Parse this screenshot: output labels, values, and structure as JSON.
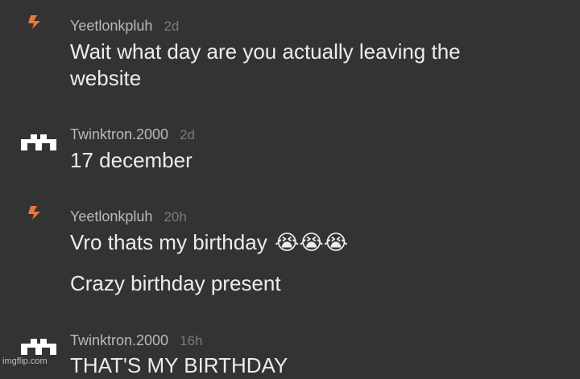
{
  "comments": [
    {
      "username": "Yeetlonkpluh",
      "time": "2d",
      "avatar_icon": "lightning-bolt-icon",
      "lines": [
        "Wait what day are you actually leaving the website"
      ]
    },
    {
      "username": "Twinktron.2000",
      "time": "2d",
      "avatar_icon": "pixel-invader-icon",
      "lines": [
        "17 december"
      ]
    },
    {
      "username": "Yeetlonkpluh",
      "time": "20h",
      "avatar_icon": "lightning-bolt-icon",
      "lines": [
        "Vro thats my birthday",
        "Crazy birthday present"
      ],
      "emojis": "😭😭😭"
    },
    {
      "username": "Twinktron.2000",
      "time": "16h",
      "avatar_icon": "pixel-invader-icon",
      "lines": [
        "THAT'S MY BIRTHDAY"
      ]
    }
  ],
  "watermark": "imgflip.com",
  "colors": {
    "background": "#333333",
    "username": "#b9b9b9",
    "timestamp": "#7c7c7c",
    "text": "#ececec",
    "bolt": "#e8793a"
  }
}
